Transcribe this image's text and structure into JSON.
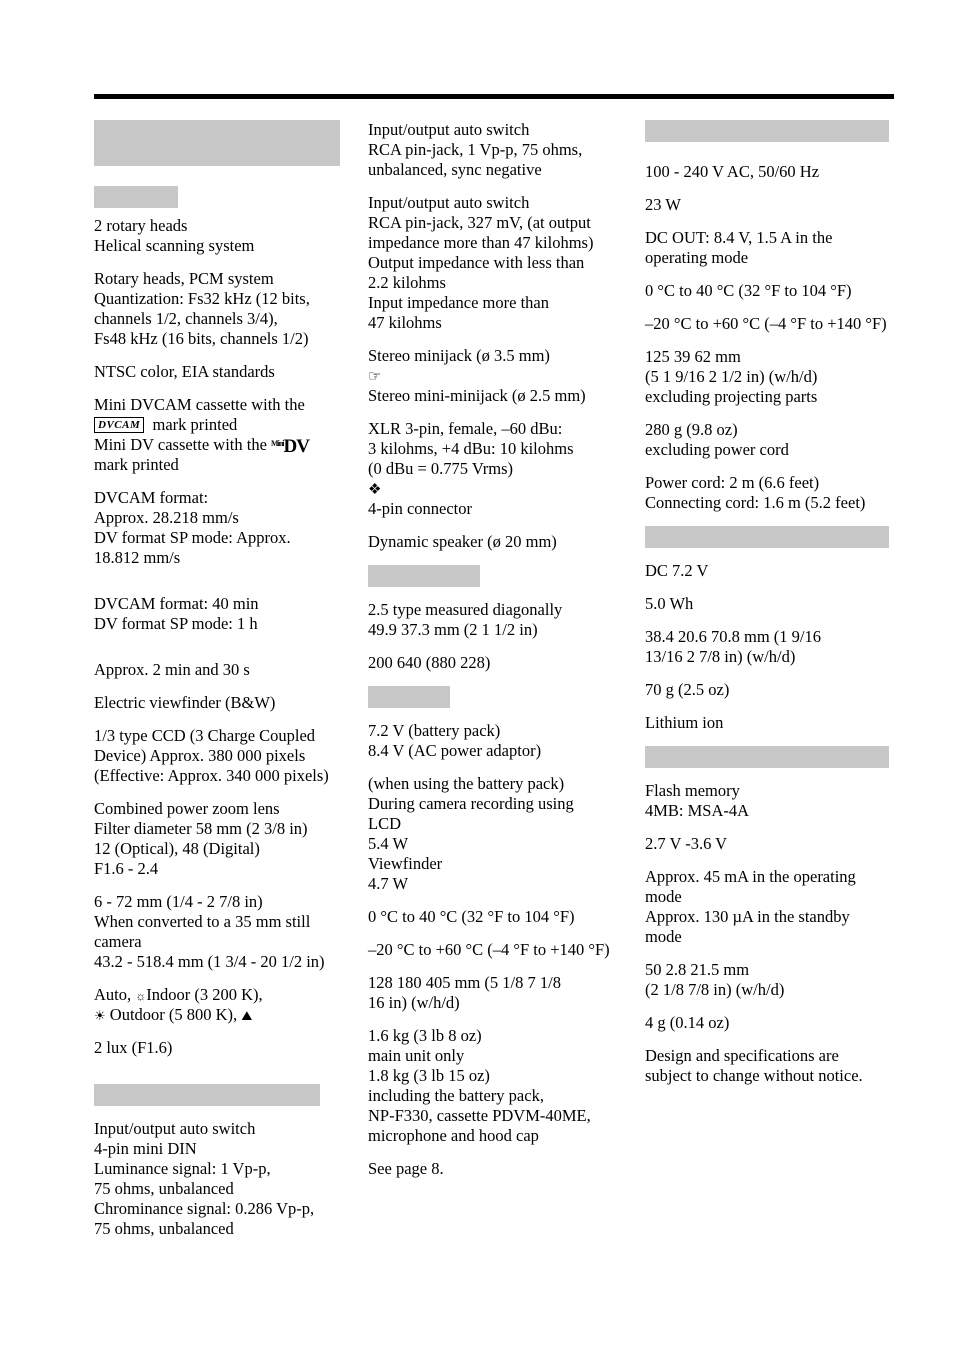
{
  "document": {
    "title": "Specifications",
    "columns": [
      {
        "id": "column-1",
        "blocks": [
          {
            "type": "header",
            "style": "tall",
            "width": "w1",
            "label": ""
          },
          {
            "type": "gap",
            "size": "sp-m"
          },
          {
            "type": "header",
            "style": "short",
            "width": "w2",
            "label": ""
          },
          {
            "type": "gap",
            "size": "sp-xs"
          },
          {
            "type": "text",
            "lines": [
              "2 rotary heads",
              "Helical scanning system"
            ]
          },
          {
            "type": "gap",
            "size": "sp-s"
          },
          {
            "type": "text",
            "lines": [
              "Rotary heads, PCM system",
              "Quantization: Fs32 kHz (12 bits,",
              "channels 1/2, channels 3/4),",
              "Fs48 kHz (16 bits, channels 1/2)"
            ]
          },
          {
            "type": "gap",
            "size": "sp-s"
          },
          {
            "type": "text",
            "lines": [
              "NTSC color, EIA standards"
            ]
          },
          {
            "type": "gap",
            "size": "sp-s"
          },
          {
            "type": "text-badges",
            "lines": [
              "Mini DVCAM cassette with the",
              "[DVCAM] mark printed",
              "Mini DV cassette with the [MiniDV]",
              "mark printed"
            ]
          },
          {
            "type": "gap",
            "size": "sp-s"
          },
          {
            "type": "text",
            "lines": [
              "DVCAM format:",
              "Approx. 28.218 mm/s",
              "DV format SP mode: Approx.",
              "18.812 mm/s"
            ]
          },
          {
            "type": "gap",
            "size": "sp-l"
          },
          {
            "type": "text",
            "lines": [
              "DVCAM format: 40 min",
              "DV format SP mode: 1 h"
            ]
          },
          {
            "type": "gap",
            "size": "sp-l"
          },
          {
            "type": "text",
            "lines": [
              "Approx. 2 min and 30 s"
            ]
          },
          {
            "type": "gap",
            "size": "sp-s"
          },
          {
            "type": "text",
            "lines": [
              "Electric viewfinder (B&W)"
            ]
          },
          {
            "type": "gap",
            "size": "sp-s"
          },
          {
            "type": "text",
            "lines": [
              "1/3 type CCD (3 Charge Coupled",
              "Device) Approx. 380 000 pixels",
              "(Effective: Approx. 340 000 pixels)"
            ]
          },
          {
            "type": "gap",
            "size": "sp-s"
          },
          {
            "type": "text",
            "lines": [
              "Combined power zoom lens",
              "Filter diameter 58 mm (2 3/8 in)",
              "12  (Optical), 48  (Digital)",
              "F1.6 - 2.4"
            ]
          },
          {
            "type": "gap",
            "size": "sp-s"
          },
          {
            "type": "text",
            "lines": [
              "6 - 72 mm (1/4 - 2 7/8 in)",
              "When converted to a 35 mm still",
              "camera",
              "43.2 - 518.4 mm (1 3/4 - 20 1/2 in)"
            ]
          },
          {
            "type": "gap",
            "size": "sp-s"
          },
          {
            "type": "text-wb",
            "lines": [
              "Auto, [bulb]Indoor (3 200 K),",
              "[sun] Outdoor (5 800 K), [outdoor]"
            ]
          },
          {
            "type": "gap",
            "size": "sp-s"
          },
          {
            "type": "text",
            "lines": [
              "2 lux (F1.6)"
            ]
          },
          {
            "type": "gap",
            "size": "sp-l"
          },
          {
            "type": "header",
            "style": "short",
            "width": "w3",
            "label": ""
          },
          {
            "type": "gap",
            "size": "sp-s"
          },
          {
            "type": "text",
            "lines": [
              "Input/output auto switch",
              "4-pin mini DIN",
              "Luminance signal: 1 Vp-p,",
              "75 ohms, unbalanced",
              "Chrominance signal: 0.286 Vp-p,",
              "75 ohms, unbalanced"
            ]
          }
        ]
      },
      {
        "id": "column-2",
        "blocks": [
          {
            "type": "text",
            "lines": [
              "Input/output auto switch",
              "RCA pin-jack, 1 Vp-p, 75 ohms,",
              "unbalanced, sync negative"
            ]
          },
          {
            "type": "gap",
            "size": "sp-s"
          },
          {
            "type": "text",
            "lines": [
              "Input/output auto switch",
              "RCA pin-jack, 327 mV, (at output",
              "impedance more than 47 kilohms)",
              "Output impedance with less than",
              "2.2 kilohms",
              "Input impedance more than",
              "47 kilohms"
            ]
          },
          {
            "type": "gap",
            "size": "sp-s"
          },
          {
            "type": "text",
            "lines": [
              "Stereo minijack (ø 3.5 mm)"
            ]
          },
          {
            "type": "text-phone",
            "lines": [
              "[phone]",
              "Stereo mini-minijack (ø 2.5 mm)"
            ]
          },
          {
            "type": "gap",
            "size": "sp-s"
          },
          {
            "type": "text",
            "lines": [
              "XLR 3-pin, female, –60 dBu:",
              "3 kilohms, +4 dBu: 10 kilohms",
              "(0 dBu = 0.775 Vrms)"
            ]
          },
          {
            "type": "text-mic",
            "lines": [
              "[mic]",
              "4-pin connector"
            ]
          },
          {
            "type": "gap",
            "size": "sp-s"
          },
          {
            "type": "text",
            "lines": [
              "Dynamic speaker (ø 20 mm)"
            ]
          },
          {
            "type": "gap",
            "size": "sp-s"
          },
          {
            "type": "header",
            "style": "short",
            "width": "w4",
            "label": ""
          },
          {
            "type": "gap",
            "size": "sp-s"
          },
          {
            "type": "text",
            "lines": [
              "2.5 type measured diagonally",
              "49.9   37.3 mm (2    1 1/2 in)"
            ]
          },
          {
            "type": "gap",
            "size": "sp-s"
          },
          {
            "type": "text",
            "lines": [
              "200 640 (880    228)"
            ]
          },
          {
            "type": "gap",
            "size": "sp-s"
          },
          {
            "type": "header",
            "style": "short",
            "width": "w5",
            "label": ""
          },
          {
            "type": "gap",
            "size": "sp-s"
          },
          {
            "type": "text",
            "lines": [
              "7.2 V (battery pack)",
              "8.4 V (AC power adaptor)"
            ]
          },
          {
            "type": "gap",
            "size": "sp-s"
          },
          {
            "type": "text",
            "lines": [
              "(when using the battery pack)",
              "During camera recording using",
              "LCD",
              "5.4 W",
              "Viewfinder",
              "4.7 W"
            ]
          },
          {
            "type": "gap",
            "size": "sp-s"
          },
          {
            "type": "text",
            "lines": [
              "0 °C to 40 °C (32 °F to 104 °F)"
            ]
          },
          {
            "type": "gap",
            "size": "sp-s"
          },
          {
            "type": "text",
            "lines": [
              "–20 °C to +60 °C (–4 °F to +140 °F)"
            ]
          },
          {
            "type": "gap",
            "size": "sp-s"
          },
          {
            "type": "text",
            "lines": [
              "128    180    405 mm (5 1/8    7 1/8",
              "  16 in) (w/h/d)"
            ]
          },
          {
            "type": "gap",
            "size": "sp-s"
          },
          {
            "type": "text",
            "lines": [
              "1.6 kg (3 lb 8 oz)",
              "main unit only",
              "1.8 kg (3 lb 15 oz)",
              "including the battery pack,",
              "NP-F330, cassette PDVM-40ME,",
              "microphone and hood cap"
            ]
          },
          {
            "type": "gap",
            "size": "sp-s"
          },
          {
            "type": "text",
            "lines": [
              "See page 8."
            ]
          }
        ]
      },
      {
        "id": "column-3",
        "blocks": [
          {
            "type": "header",
            "style": "short",
            "width": "w6",
            "label": ""
          },
          {
            "type": "gap",
            "size": "sp-m"
          },
          {
            "type": "text",
            "lines": [
              "100 - 240 V AC, 50/60 Hz"
            ]
          },
          {
            "type": "gap",
            "size": "sp-s"
          },
          {
            "type": "text",
            "lines": [
              "23 W"
            ]
          },
          {
            "type": "gap",
            "size": "sp-s"
          },
          {
            "type": "text",
            "lines": [
              "DC OUT: 8.4 V, 1.5 A in the",
              "operating mode"
            ]
          },
          {
            "type": "gap",
            "size": "sp-s"
          },
          {
            "type": "text",
            "lines": [
              "0 °C to 40 °C (32 °F to 104 °F)"
            ]
          },
          {
            "type": "gap",
            "size": "sp-s"
          },
          {
            "type": "text",
            "lines": [
              "–20 °C to +60 °C (–4 °F to +140 °F)"
            ]
          },
          {
            "type": "gap",
            "size": "sp-s"
          },
          {
            "type": "text",
            "lines": [
              "125    39    62 mm",
              "(5    1 9/16    2 1/2 in) (w/h/d)",
              "excluding projecting parts"
            ]
          },
          {
            "type": "gap",
            "size": "sp-s"
          },
          {
            "type": "text",
            "lines": [
              "280 g (9.8 oz)",
              "excluding power cord"
            ]
          },
          {
            "type": "gap",
            "size": "sp-s"
          },
          {
            "type": "text",
            "lines": [
              "Power cord: 2 m (6.6 feet)",
              "Connecting cord: 1.6 m (5.2 feet)"
            ]
          },
          {
            "type": "gap",
            "size": "sp-s"
          },
          {
            "type": "header",
            "style": "short",
            "width": "w6",
            "label": ""
          },
          {
            "type": "gap",
            "size": "sp-s"
          },
          {
            "type": "text",
            "lines": [
              "DC 7.2 V"
            ]
          },
          {
            "type": "gap",
            "size": "sp-s"
          },
          {
            "type": "text",
            "lines": [
              "5.0 Wh"
            ]
          },
          {
            "type": "gap",
            "size": "sp-s"
          },
          {
            "type": "text",
            "lines": [
              "38.4    20.6    70.8 mm (1 9/16",
              "13/16    2 7/8 in) (w/h/d)"
            ]
          },
          {
            "type": "gap",
            "size": "sp-s"
          },
          {
            "type": "text",
            "lines": [
              "70 g (2.5 oz)"
            ]
          },
          {
            "type": "gap",
            "size": "sp-s"
          },
          {
            "type": "text",
            "lines": [
              "Lithium ion"
            ]
          },
          {
            "type": "gap",
            "size": "sp-s"
          },
          {
            "type": "header",
            "style": "short",
            "width": "w6",
            "label": ""
          },
          {
            "type": "gap",
            "size": "sp-s"
          },
          {
            "type": "text",
            "lines": [
              "Flash memory",
              "4MB: MSA-4A"
            ]
          },
          {
            "type": "gap",
            "size": "sp-s"
          },
          {
            "type": "text",
            "lines": [
              "2.7 V -3.6 V"
            ]
          },
          {
            "type": "gap",
            "size": "sp-s"
          },
          {
            "type": "text",
            "lines": [
              "Approx. 45 mA in the operating",
              "mode",
              "Approx. 130 µA in the standby",
              "mode"
            ]
          },
          {
            "type": "gap",
            "size": "sp-s"
          },
          {
            "type": "text",
            "lines": [
              "50    2.8    21.5 mm",
              "(2    1/8    7/8  in) (w/h/d)"
            ]
          },
          {
            "type": "gap",
            "size": "sp-s"
          },
          {
            "type": "text",
            "lines": [
              "4 g (0.14 oz)"
            ]
          },
          {
            "type": "gap",
            "size": "sp-s"
          },
          {
            "type": "text",
            "lines": [
              "Design and specifications are",
              "subject to change without notice."
            ]
          }
        ]
      }
    ],
    "icons": {
      "dvcam_badge": "DVCAM",
      "minidv_badge_mini": "Mini",
      "minidv_badge_dv": "DV",
      "headphone_icon": "☎",
      "mic_icon": "ᵍ",
      "bulb_icon": "☀",
      "sun_icon": "☀",
      "outdoor_icon": "⛰"
    }
  }
}
